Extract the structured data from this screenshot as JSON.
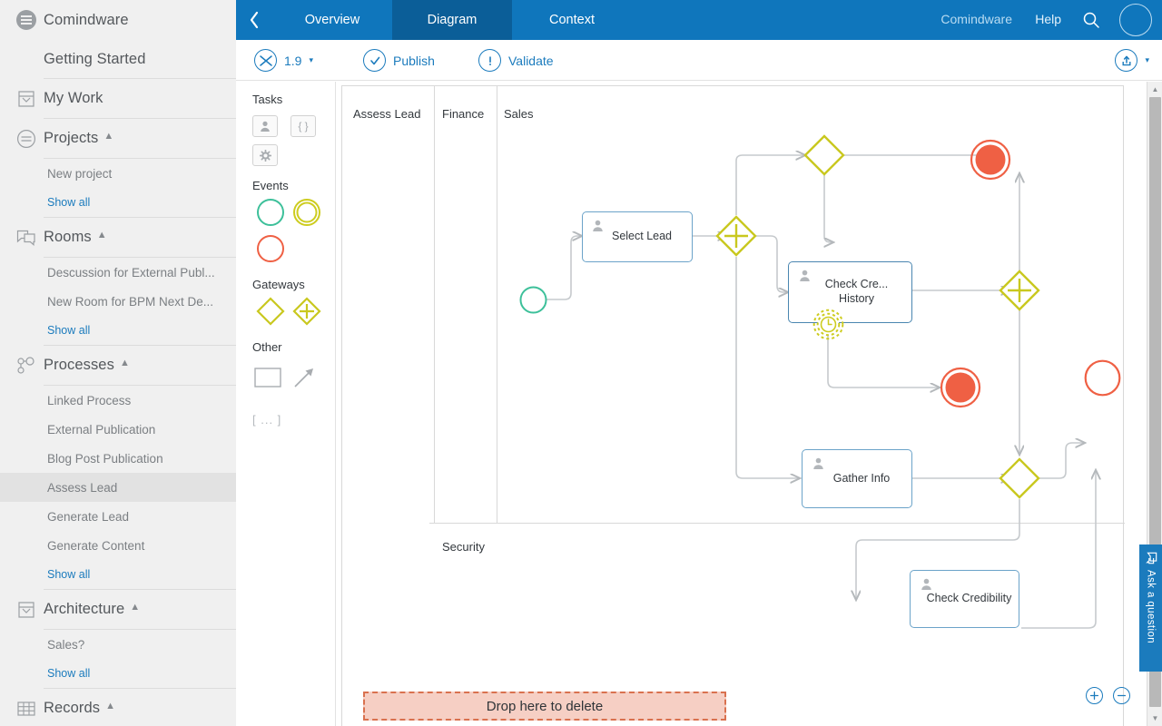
{
  "app": {
    "name": "Comindware"
  },
  "sidebar": {
    "brand": "Comindware",
    "getting_started": "Getting Started",
    "my_work": "My Work",
    "groups": [
      {
        "label": "Projects",
        "icon": "projects-icon",
        "items": [
          {
            "label": "New project",
            "type": "link"
          },
          {
            "label": "Show all",
            "type": "showall"
          }
        ]
      },
      {
        "label": "Rooms",
        "icon": "rooms-icon",
        "items": [
          {
            "label": "Descussion for External Publ...",
            "type": "link"
          },
          {
            "label": "New Room for BPM Next De...",
            "type": "link"
          },
          {
            "label": "Show all",
            "type": "showall"
          }
        ]
      },
      {
        "label": "Processes",
        "icon": "processes-icon",
        "items": [
          {
            "label": "Linked Process",
            "type": "link"
          },
          {
            "label": "External Publication",
            "type": "link"
          },
          {
            "label": "Blog Post Publication",
            "type": "link"
          },
          {
            "label": "Assess Lead",
            "type": "link",
            "selected": true
          },
          {
            "label": "Generate Lead",
            "type": "link"
          },
          {
            "label": "Generate Content",
            "type": "link"
          },
          {
            "label": "Show all",
            "type": "showall"
          }
        ]
      },
      {
        "label": "Architecture",
        "icon": "architecture-icon",
        "items": [
          {
            "label": "Sales?",
            "type": "link"
          },
          {
            "label": "Show all",
            "type": "showall"
          }
        ]
      },
      {
        "label": "Records",
        "icon": "records-icon",
        "items": []
      }
    ]
  },
  "topbar": {
    "back_label": "‹",
    "tabs": [
      {
        "label": "Overview",
        "active": false
      },
      {
        "label": "Diagram",
        "active": true
      },
      {
        "label": "Context",
        "active": false
      }
    ],
    "brand_link": "Comindware",
    "help_link": "Help",
    "search_icon": "search-icon",
    "avatar_icon": "avatar"
  },
  "toolbar": {
    "version_icon": "shuffle-icon",
    "version": "1.9",
    "version_caret": "▾",
    "publish_label": "Publish",
    "publish_icon": "check-circle-icon",
    "validate_label": "Validate",
    "validate_icon": "exclamation-circle-icon",
    "export_icon": "upload-share-icon",
    "export_caret": "▾"
  },
  "palette": {
    "sections": [
      {
        "title": "Tasks",
        "items": [
          {
            "name": "user-task",
            "glyph": "person"
          },
          {
            "name": "script-task",
            "glyph": "braces"
          },
          {
            "name": "service-task",
            "glyph": "gear"
          }
        ]
      },
      {
        "title": "Events",
        "items": [
          {
            "name": "start-event",
            "glyph": "circle",
            "color": "#3dc09a"
          },
          {
            "name": "intermediate-event",
            "glyph": "double-circle",
            "color": "#cdcc1f"
          },
          {
            "name": "end-event",
            "glyph": "circle",
            "color": "#ef6044"
          }
        ]
      },
      {
        "title": "Gateways",
        "items": [
          {
            "name": "exclusive-gateway",
            "glyph": "diamond",
            "color": "#c9c81f"
          },
          {
            "name": "parallel-gateway",
            "glyph": "diamond-plus",
            "color": "#c9c81f"
          }
        ]
      },
      {
        "title": "Other",
        "items": [
          {
            "name": "pool-lane",
            "glyph": "rect"
          },
          {
            "name": "connector-arrow",
            "glyph": "arrow"
          },
          {
            "name": "group-bracket",
            "glyph": "bracket",
            "label": "[ ... ]"
          }
        ]
      }
    ]
  },
  "diagram": {
    "lanes": [
      {
        "label": "Assess Lead"
      },
      {
        "label": "Finance"
      },
      {
        "label": "Sales"
      },
      {
        "label": "Security"
      }
    ],
    "nodes": [
      {
        "id": "start",
        "type": "start-event",
        "label": ""
      },
      {
        "id": "select-lead",
        "type": "user-task",
        "label": "Select Lead"
      },
      {
        "id": "gw-parallel-1",
        "type": "parallel-gateway",
        "label": ""
      },
      {
        "id": "gw-exclusive-1",
        "type": "exclusive-gateway",
        "label": ""
      },
      {
        "id": "check-credit-history",
        "type": "user-task",
        "label": "Check Cre...\nHistory",
        "boundary": "timer-event"
      },
      {
        "id": "gw-parallel-2",
        "type": "parallel-gateway",
        "label": ""
      },
      {
        "id": "end-1",
        "type": "end-event",
        "label": ""
      },
      {
        "id": "end-2",
        "type": "end-event",
        "label": ""
      },
      {
        "id": "intermediate-1",
        "type": "intermediate-event",
        "label": ""
      },
      {
        "id": "gather-info",
        "type": "user-task",
        "label": "Gather Info"
      },
      {
        "id": "gw-exclusive-2",
        "type": "exclusive-gateway",
        "label": ""
      },
      {
        "id": "check-credibility",
        "type": "user-task",
        "label": "Check Credibility"
      }
    ],
    "delete_zone_label": "Drop here to delete",
    "zoom_in": "+",
    "zoom_out": "−"
  },
  "ask": {
    "label": "Ask a question",
    "icon": "chat-bubble-icon"
  },
  "colors": {
    "brand_blue": "#0f76bc",
    "active_tab_blue": "#0b5e98",
    "link_blue": "#1b7bbd",
    "task_border": "#6ba3c9",
    "gateway_yellow": "#c9c81f",
    "start_green": "#3dc09a",
    "end_red": "#ef6044",
    "delete_zone_bg": "#f6cfc4",
    "delete_zone_border": "#d9714f"
  }
}
